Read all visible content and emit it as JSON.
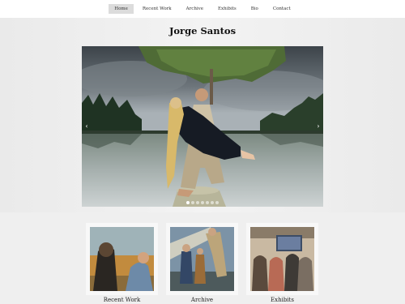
{
  "nav": {
    "items": [
      {
        "label": "Home",
        "active": true
      },
      {
        "label": "Recent Work",
        "active": false
      },
      {
        "label": "Archive",
        "active": false
      },
      {
        "label": "Exhibits",
        "active": false
      },
      {
        "label": "Bio",
        "active": false
      },
      {
        "label": "Contact",
        "active": false
      }
    ]
  },
  "site": {
    "title": "Jorge Santos"
  },
  "slideshow": {
    "prev_icon": "‹",
    "next_icon": "›",
    "slide_count": 7,
    "active_slide": 1
  },
  "tiles": [
    {
      "label": "Recent Work"
    },
    {
      "label": "Archive"
    },
    {
      "label": "Exhibits"
    }
  ],
  "colors": {
    "background": "#efefef",
    "nav_background": "#ffffff",
    "nav_active": "#dcdcdc"
  }
}
